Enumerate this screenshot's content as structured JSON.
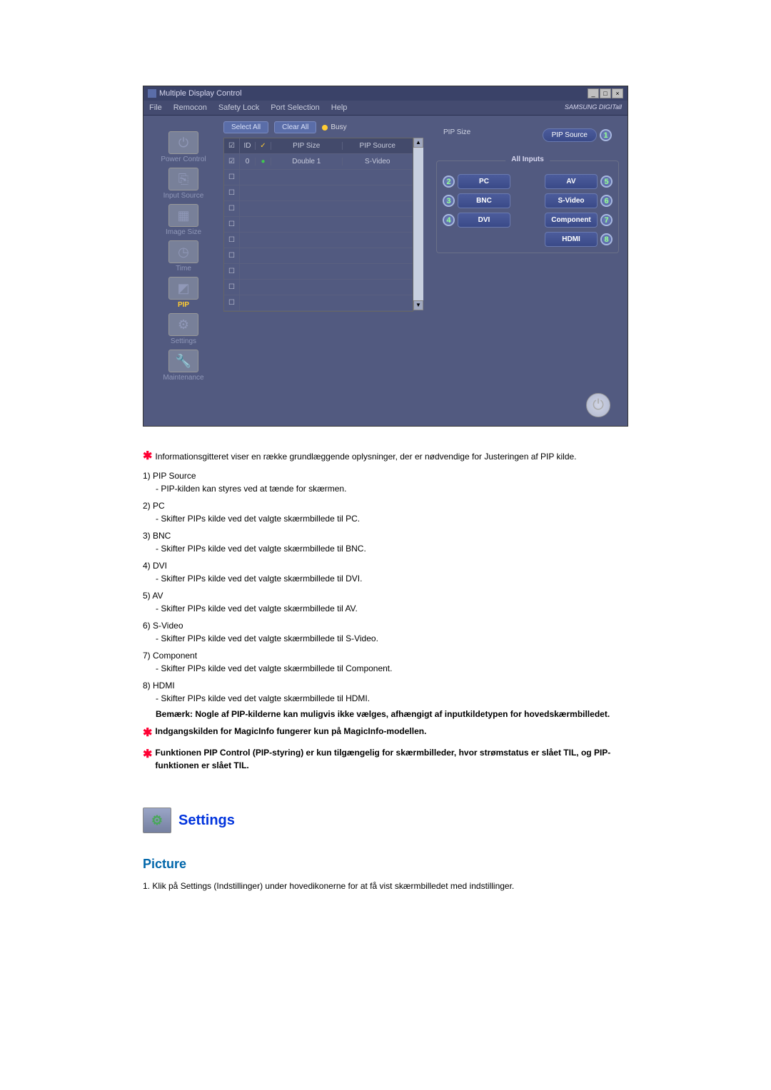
{
  "window": {
    "title": "Multiple Display Control",
    "min": "_",
    "restore": "□",
    "close": "×"
  },
  "menu": {
    "items": [
      "File",
      "Remocon",
      "Safety Lock",
      "Port Selection",
      "Help"
    ],
    "brand": "SAMSUNG DIGITall"
  },
  "sidebar": [
    {
      "label": "Power Control"
    },
    {
      "label": "Input Source"
    },
    {
      "label": "Image Size"
    },
    {
      "label": "Time"
    },
    {
      "label": "PIP",
      "active": true
    },
    {
      "label": "Settings"
    },
    {
      "label": "Maintenance"
    }
  ],
  "toolbar": {
    "select_all": "Select All",
    "clear_all": "Clear All",
    "busy": "Busy"
  },
  "table": {
    "headers": {
      "chk": "☑",
      "id": "ID",
      "st": "",
      "a": "PIP Size",
      "b": "PIP Source"
    },
    "row0": {
      "chk": "☑",
      "id": "0",
      "st": "●",
      "a": "Double 1",
      "b": "S-Video"
    },
    "blank_rows": 8
  },
  "right": {
    "pip_size_label": "PIP Size",
    "pip_source_label": "PIP Source",
    "pip_source_num": "1",
    "all_inputs": "All Inputs",
    "buttons": [
      {
        "num": "2",
        "label": "PC",
        "side": "left"
      },
      {
        "num": "5",
        "label": "AV",
        "side": "right"
      },
      {
        "num": "3",
        "label": "BNC",
        "side": "left"
      },
      {
        "num": "6",
        "label": "S-Video",
        "side": "right"
      },
      {
        "num": "4",
        "label": "DVI",
        "side": "left"
      },
      {
        "num": "7",
        "label": "Component",
        "side": "right"
      },
      {
        "num": "8",
        "label": "HDMI",
        "side": "right"
      }
    ]
  },
  "doc": {
    "intro": "Informationsgitteret viser en række grundlæggende oplysninger, der er nødvendige for Justeringen af PIP kilde.",
    "items": [
      {
        "n": "1)",
        "t": "PIP Source",
        "d": "- PIP-kilden kan styres ved at tænde for skærmen."
      },
      {
        "n": "2)",
        "t": "PC",
        "d": "- Skifter PIPs kilde ved det valgte skærmbillede til PC."
      },
      {
        "n": "3)",
        "t": "BNC",
        "d": "- Skifter PIPs kilde ved det valgte skærmbillede til BNC."
      },
      {
        "n": "4)",
        "t": "DVI",
        "d": "- Skifter PIPs kilde ved det valgte skærmbillede til DVI."
      },
      {
        "n": "5)",
        "t": "AV",
        "d": "- Skifter PIPs kilde ved det valgte skærmbillede til AV."
      },
      {
        "n": "6)",
        "t": "S-Video",
        "d": "- Skifter PIPs kilde ved det valgte skærmbillede til S-Video."
      },
      {
        "n": "7)",
        "t": "Component",
        "d": "- Skifter PIPs kilde ved det valgte skærmbillede til Component."
      },
      {
        "n": "8)",
        "t": "HDMI",
        "d": "- Skifter PIPs kilde ved det valgte skærmbillede til HDMI."
      }
    ],
    "note": "Bemærk: Nogle af PIP-kilderne kan muligvis ikke vælges, afhængigt af inputkildetypen for hovedskærmbilledet.",
    "star1": "Indgangskilden for MagicInfo fungerer kun på MagicInfo-modellen.",
    "star2": "Funktionen PIP Control (PIP-styring) er kun tilgængelig for skærmbilleder, hvor strømstatus er slået TIL, og PIP-funktionen er slået TIL."
  },
  "settings": {
    "heading": "Settings",
    "picture": "Picture",
    "picture_text": "1. Klik på Settings (Indstillinger) under hovedikonerne for at få vist skærmbilledet med indstillinger."
  }
}
